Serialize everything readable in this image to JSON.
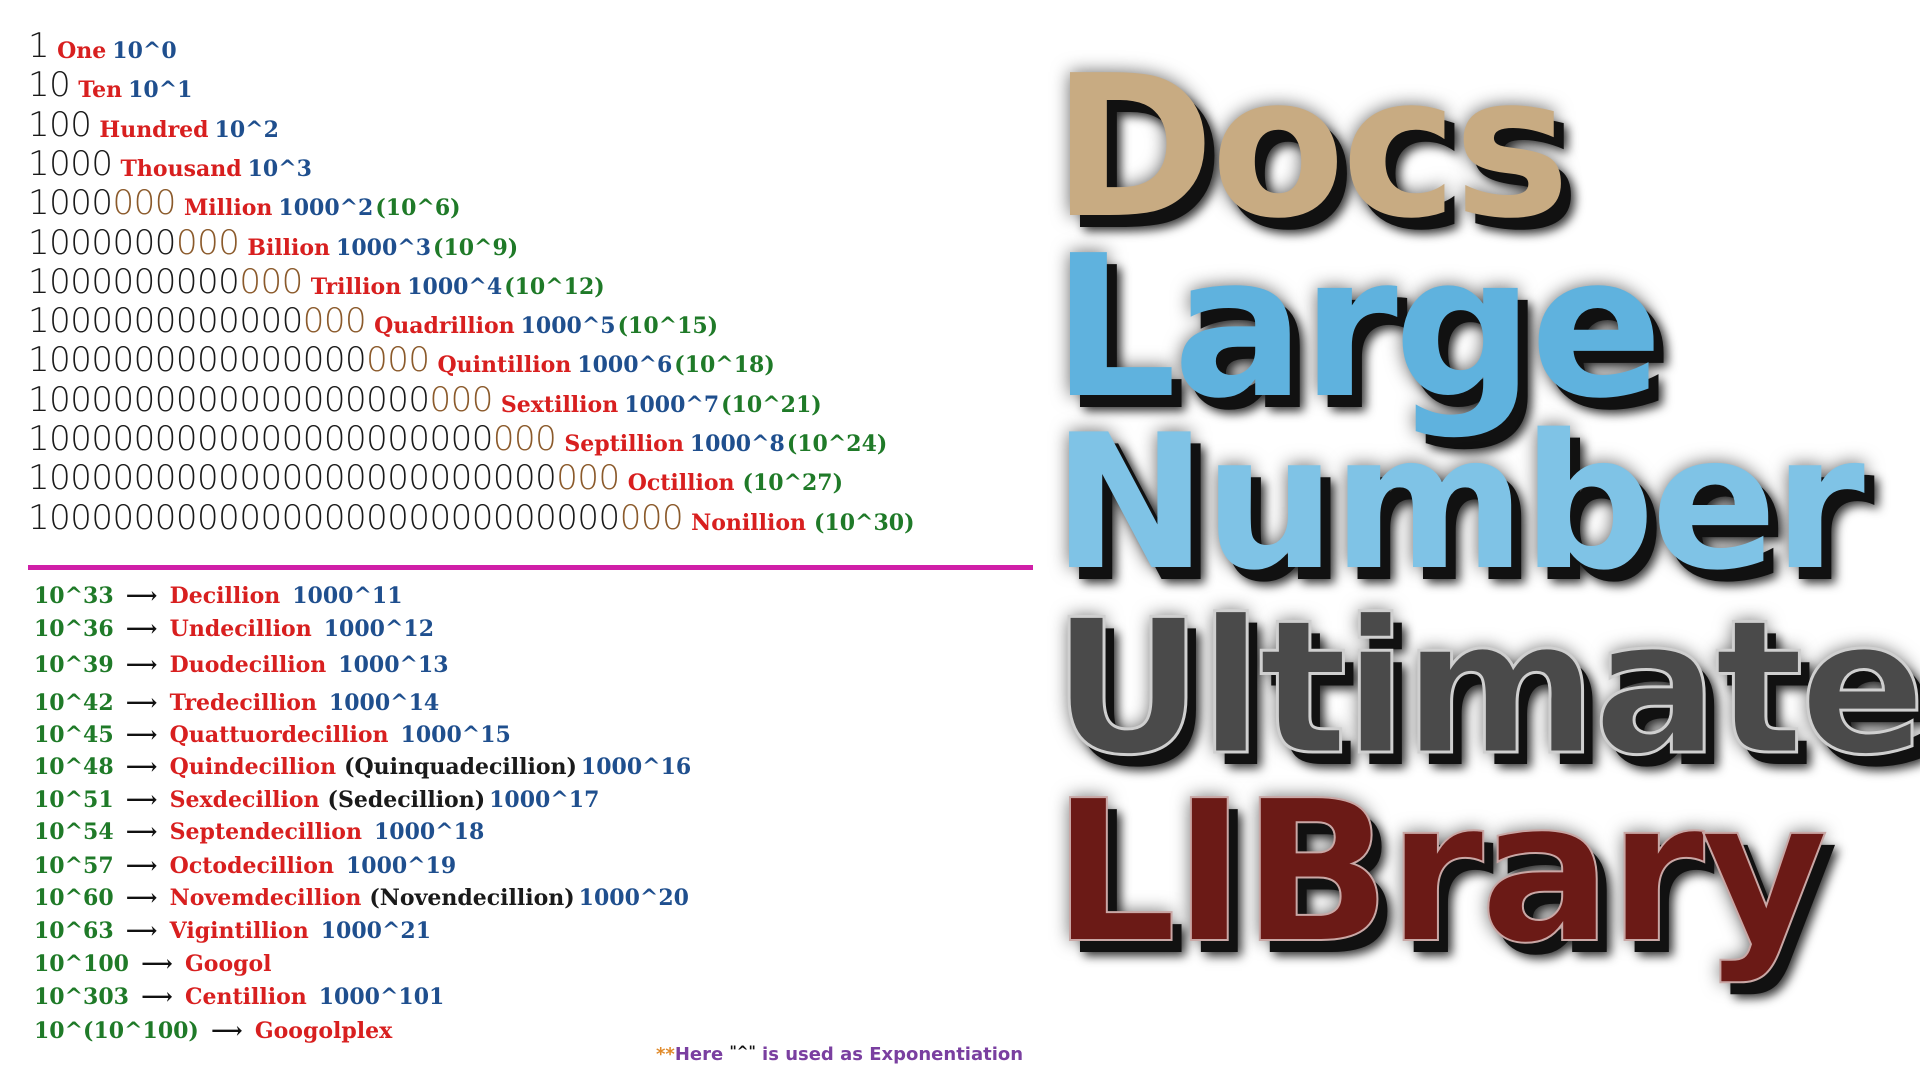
{
  "staircase": [
    {
      "base": "1",
      "new": "",
      "name": "One",
      "pow": "10^0",
      "sci": ""
    },
    {
      "base": "10",
      "new": "",
      "name": "Ten",
      "pow": "10^1",
      "sci": ""
    },
    {
      "base": "100",
      "new": "",
      "name": "Hundred",
      "pow": "10^2",
      "sci": ""
    },
    {
      "base": "1000",
      "new": "",
      "name": "Thousand",
      "pow": "10^3",
      "sci": ""
    },
    {
      "base": "1000",
      "new": "000",
      "name": "Million",
      "pow": "1000^2",
      "sci": "(10^6)"
    },
    {
      "base": "1000000",
      "new": "000",
      "name": "Billion",
      "pow": "1000^3",
      "sci": "(10^9)"
    },
    {
      "base": "1000000000",
      "new": "000",
      "name": "Trillion",
      "pow": "1000^4",
      "sci": "(10^12)"
    },
    {
      "base": "1000000000000",
      "new": "000",
      "name": "Quadrillion",
      "pow": "1000^5",
      "sci": "(10^15)"
    },
    {
      "base": "1000000000000000",
      "new": "000",
      "name": "Quintillion",
      "pow": "1000^6",
      "sci": "(10^18)"
    },
    {
      "base": "1000000000000000000",
      "new": "000",
      "name": "Sextillion",
      "pow": "1000^7",
      "sci": "(10^21)"
    },
    {
      "base": "1000000000000000000000",
      "new": "000",
      "name": "Septillion",
      "pow": "1000^8",
      "sci": "(10^24)"
    },
    {
      "base": "1000000000000000000000000",
      "new": "000",
      "name": "Octillion",
      "pow": "",
      "sci": "(10^27)"
    },
    {
      "base": "1000000000000000000000000000",
      "new": "000",
      "name": "Nonillion",
      "pow": "",
      "sci": "(10^30)"
    }
  ],
  "big_names": [
    {
      "exp": "10^33",
      "name": "Decillion",
      "alt": "",
      "pow": "1000^11"
    },
    {
      "exp": "10^36",
      "name": "Undecillion",
      "alt": "",
      "pow": "1000^12"
    },
    {
      "exp": "10^39",
      "name": "Duodecillion",
      "alt": "",
      "pow": "1000^13"
    },
    {
      "exp": "10^42",
      "name": "Tredecillion",
      "alt": "",
      "pow": "1000^14"
    },
    {
      "exp": "10^45",
      "name": "Quattuordecillion",
      "alt": "",
      "pow": "1000^15"
    },
    {
      "exp": "10^48",
      "name": "Quindecillion",
      "alt": "(Quinquadecillion)",
      "pow": "1000^16"
    },
    {
      "exp": "10^51",
      "name": "Sexdecillion",
      "alt": "(Sedecillion)",
      "pow": "1000^17"
    },
    {
      "exp": "10^54",
      "name": "Septendecillion",
      "alt": "",
      "pow": "1000^18"
    },
    {
      "exp": "10^57",
      "name": "Octodecillion",
      "alt": "",
      "pow": "1000^19"
    },
    {
      "exp": "10^60",
      "name": "Novemdecillion",
      "alt": "(Novendecillion)",
      "pow": "1000^20"
    },
    {
      "exp": "10^63",
      "name": "Vigintillion",
      "alt": "",
      "pow": "1000^21"
    },
    {
      "exp": "10^100",
      "name": "Googol",
      "alt": "",
      "pow": ""
    },
    {
      "exp": "10^303",
      "name": "Centillion",
      "alt": "",
      "pow": "1000^101"
    },
    {
      "exp": "10^(10^100)",
      "name": "Googolplex",
      "alt": "",
      "pow": ""
    }
  ],
  "arrow": "⟶",
  "note": {
    "stars": "**",
    "before": "Here ",
    "caret": "\"^\"",
    "after": " is used as Exponentiation"
  },
  "title": {
    "word1": "Docs",
    "word2": "Large",
    "word3": "Number",
    "word4": "Ultimate",
    "word5": "LIBrary"
  },
  "colors": {
    "name": "#d81f1f",
    "power": "#1f4f8e",
    "scientific": "#1f7a28",
    "new_digits": "#8b5a2b",
    "divider": "#d01fa8"
  }
}
